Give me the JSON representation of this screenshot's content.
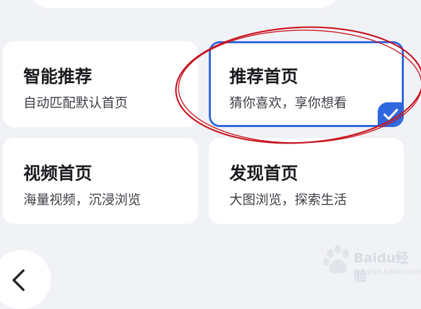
{
  "cards": [
    {
      "id": "smart",
      "title": "智能推荐",
      "desc": "自动匹配默认首页",
      "selected": false
    },
    {
      "id": "recommend",
      "title": "推荐首页",
      "desc": "猜你喜欢，享你想看",
      "selected": true
    },
    {
      "id": "video",
      "title": "视频首页",
      "desc": "海量视频，沉浸浏览",
      "selected": false
    },
    {
      "id": "discover",
      "title": "发现首页",
      "desc": "大图浏览，探索生活",
      "selected": false
    }
  ],
  "icons": {
    "selected": "checkmark-icon",
    "back": "chevron-left-icon"
  },
  "colors": {
    "accent": "#2f67de",
    "annotation": "#c8141e",
    "background": "#f1f2f6",
    "card": "#ffffff"
  },
  "watermark": {
    "brand": "Baidu经验",
    "url": "jingyan.baidu.com"
  }
}
